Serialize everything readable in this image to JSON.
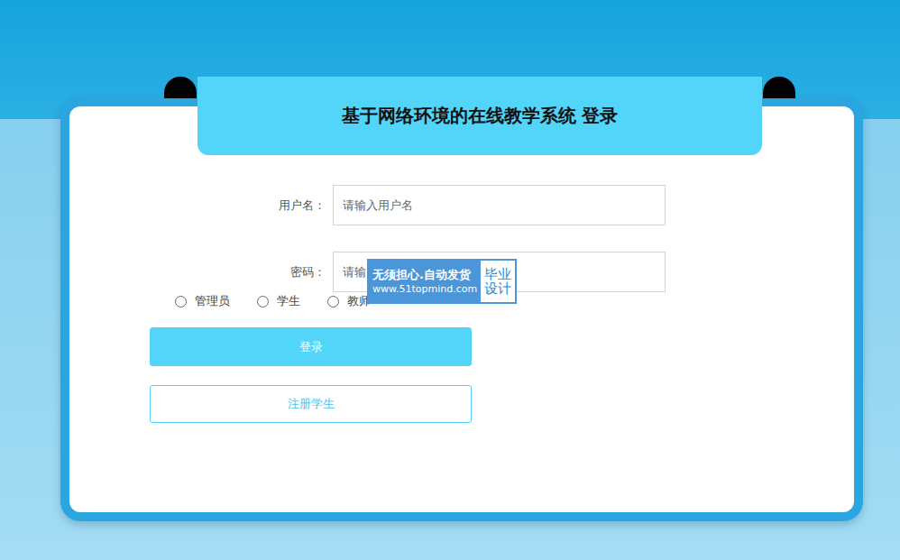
{
  "window": {
    "title": "基于网络环境的在线教学系统 登录"
  },
  "fields": [
    {
      "label": "用户名：",
      "placeholder": "请输入用户名",
      "kind": "text"
    },
    {
      "label": "密码：",
      "placeholder": "请输",
      "kind": "password"
    }
  ],
  "roles": [
    {
      "label": "管理员",
      "selected": false
    },
    {
      "label": "学生",
      "selected": false
    },
    {
      "label": "教师",
      "selected": false
    }
  ],
  "buttons": {
    "login": "登录",
    "register": "注册学生"
  },
  "watermark": {
    "line1": "无须担心.自动发货",
    "line2": "www.51topmind.com",
    "badge": "毕业设计"
  }
}
